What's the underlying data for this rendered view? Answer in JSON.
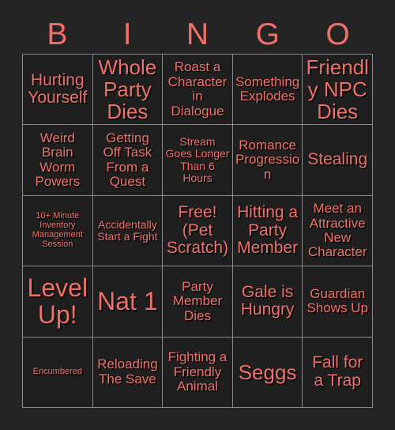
{
  "card": {
    "header_letters": [
      "B",
      "I",
      "N",
      "G",
      "O"
    ],
    "accent_color": "#F07069",
    "background_color": "#242424",
    "cell_color": "#1f1f1f",
    "border_color": "#8a8a8a",
    "rows": [
      [
        {
          "text": "Hurting Yourself",
          "size": "l"
        },
        {
          "text": "Whole Party Dies",
          "size": "xl"
        },
        {
          "text": "Roast a Character in Dialogue",
          "size": "m"
        },
        {
          "text": "Something Explodes",
          "size": "m"
        },
        {
          "text": "Friendly NPC Dies",
          "size": "xl"
        }
      ],
      [
        {
          "text": "Weird Brain Worm Powers",
          "size": "m"
        },
        {
          "text": "Getting Off Task From a Quest",
          "size": "m"
        },
        {
          "text": "Stream Goes Longer Than 6 Hours",
          "size": "s"
        },
        {
          "text": "Romance Progression",
          "size": "m"
        },
        {
          "text": "Stealing",
          "size": "l"
        }
      ],
      [
        {
          "text": "10+ Minute Inventory Management Session",
          "size": "xs"
        },
        {
          "text": "Accidentally Start a Fight",
          "size": "s"
        },
        {
          "text": "Free! (Pet Scratch)",
          "size": "l"
        },
        {
          "text": "Hitting a Party Member",
          "size": "l"
        },
        {
          "text": "Meet an Attractive New Character",
          "size": "m"
        }
      ],
      [
        {
          "text": "Level Up!",
          "size": "xxl"
        },
        {
          "text": "Nat 1",
          "size": "xxl"
        },
        {
          "text": "Party Member Dies",
          "size": "m"
        },
        {
          "text": "Gale is Hungry",
          "size": "l"
        },
        {
          "text": "Guardian Shows Up",
          "size": "m"
        }
      ],
      [
        {
          "text": "Encumbered",
          "size": "xs"
        },
        {
          "text": "Reloading The Save",
          "size": "m"
        },
        {
          "text": "Fighting a Friendly Animal",
          "size": "m"
        },
        {
          "text": "Seggs",
          "size": "xl"
        },
        {
          "text": "Fall for a Trap",
          "size": "l"
        }
      ]
    ]
  }
}
